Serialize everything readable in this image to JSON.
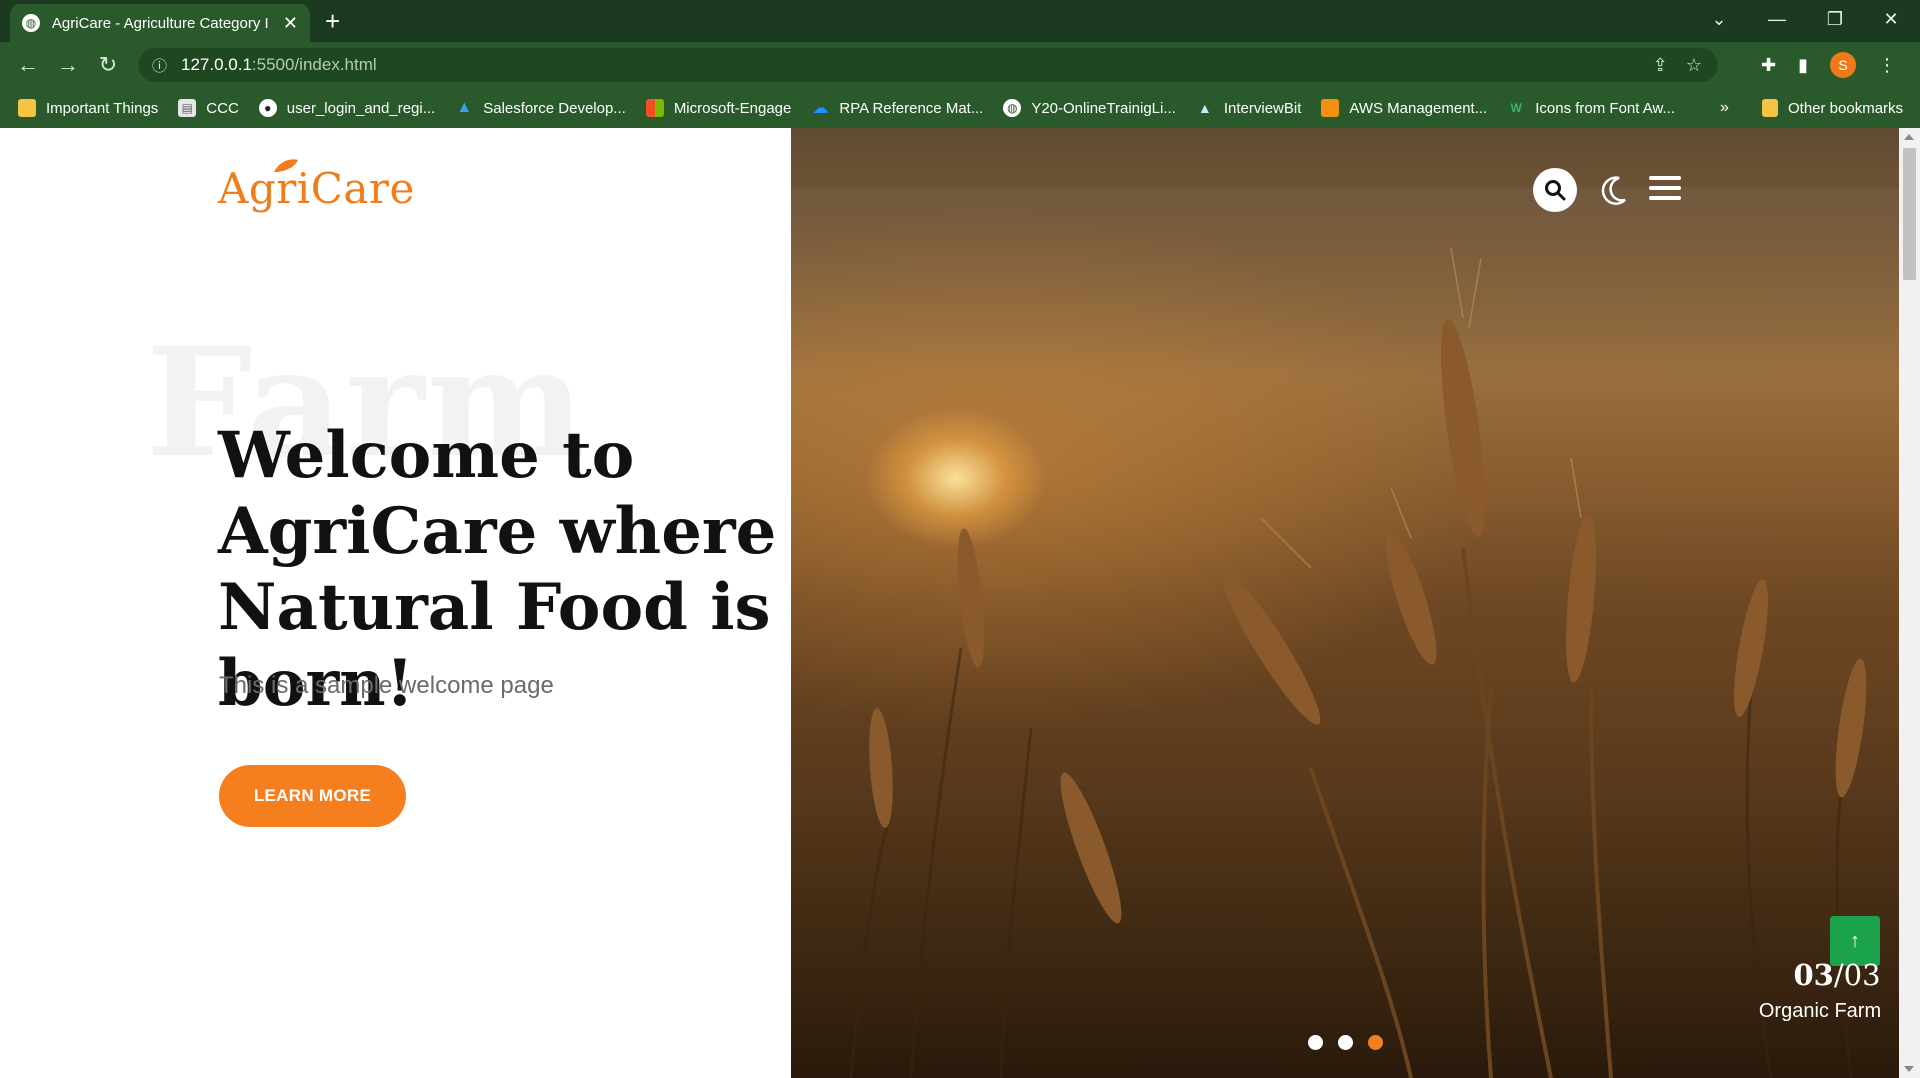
{
  "browser": {
    "tab_title": "AgriCare - Agriculture Category I",
    "url_host": "127.0.0.1",
    "url_rest": ":5500/index.html",
    "profile_initial": "S",
    "bookmarks": [
      {
        "label": "Important Things",
        "icon": "folder-icon",
        "color": "#f5c542"
      },
      {
        "label": "CCC",
        "icon": "page-icon",
        "color": "#e6e6e6"
      },
      {
        "label": "user_login_and_regi...",
        "icon": "github-icon",
        "color": "#ffffff"
      },
      {
        "label": "Salesforce Develop...",
        "icon": "trailhead-icon",
        "color": "#3aa0e8"
      },
      {
        "label": "Microsoft-Engage",
        "icon": "microsoft-icon",
        "color": "#f25022"
      },
      {
        "label": "RPA Reference Mat...",
        "icon": "cloud-icon",
        "color": "#1e90ff"
      },
      {
        "label": "Y20-OnlineTrainigLi...",
        "icon": "globe-icon",
        "color": "#ffffff"
      },
      {
        "label": "InterviewBit",
        "icon": "mountain-icon",
        "color": "#cfe3ff"
      },
      {
        "label": "AWS Management...",
        "icon": "aws-icon",
        "color": "#f29111"
      },
      {
        "label": "Icons from Font Aw...",
        "icon": "w-icon",
        "color": "#38b36a"
      }
    ],
    "bookmarks_more": "»",
    "other_bookmarks": "Other bookmarks"
  },
  "page": {
    "logo": "AgriCare",
    "background_word": "Farm",
    "headline": "Welcome to AgriCare where Natural Food is born!",
    "subtext": "This is a sample welcome page",
    "cta_label": "LEARN MORE",
    "slide_current": "03",
    "slide_total": "/03",
    "slide_label": "Organic Farm",
    "active_slide": 3,
    "slide_count": 3
  },
  "colors": {
    "accent": "#f57f1f",
    "scroll_top_button": "#1aa34a",
    "browser_frame": "#2a5a2c"
  }
}
